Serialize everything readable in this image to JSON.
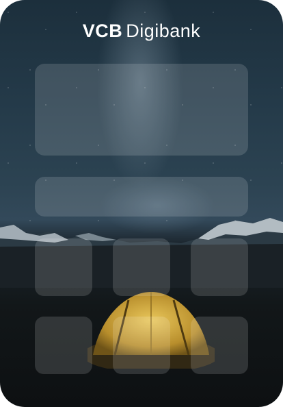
{
  "brand": {
    "name_bold": "VCB",
    "name_light": "Digibank"
  },
  "theme": {
    "panel_color": "rgba(255,255,255,0.14)",
    "sky_color": "#243a49",
    "tent_color": "#c9a340"
  }
}
